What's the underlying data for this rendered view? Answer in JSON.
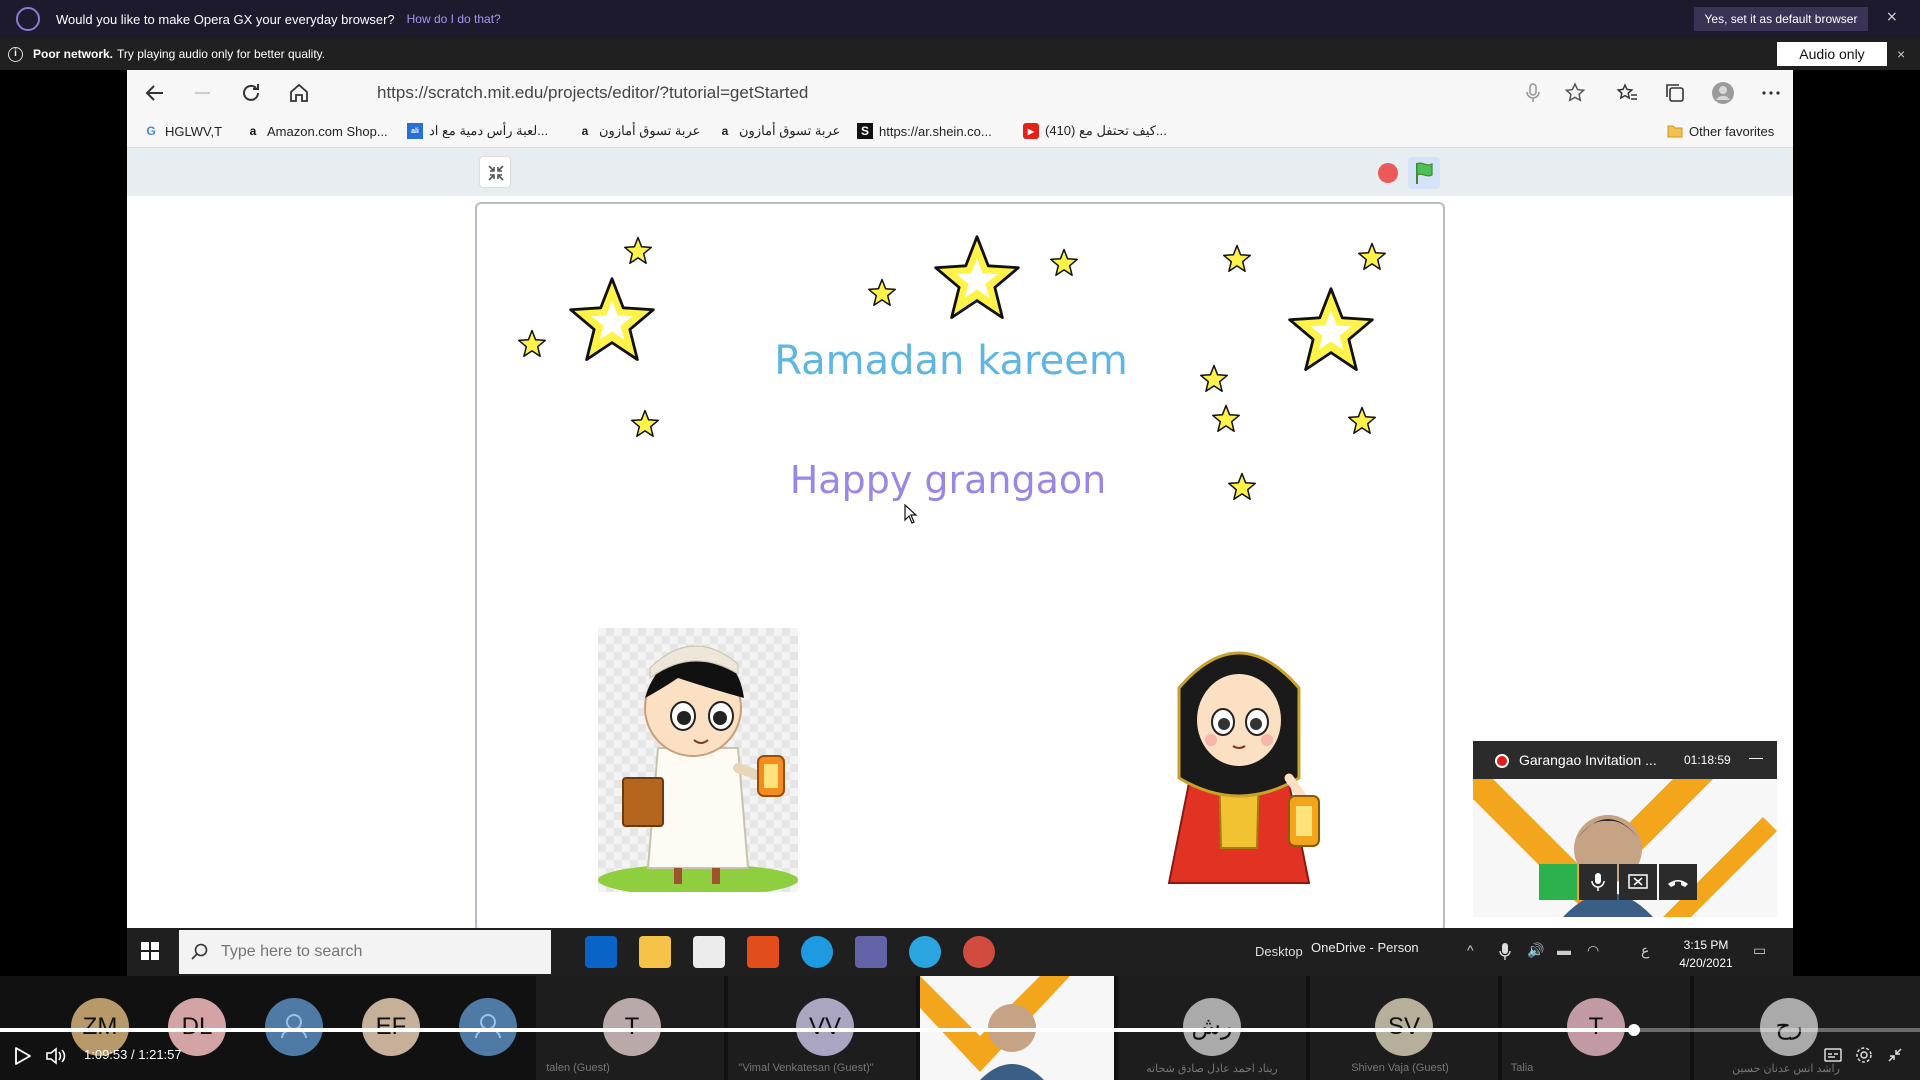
{
  "opera_bar": {
    "message": "Would you like to make Opera GX your everyday browser?",
    "link": "How do I do that?",
    "default_button": "Yes, set it as default browser",
    "close": "×"
  },
  "network_bar": {
    "title": "Poor network.",
    "text": "Try playing audio only for better quality.",
    "audio_only_button": "Audio only",
    "close": "×"
  },
  "browser": {
    "url": "https://scratch.mit.edu/projects/editor/?tutorial=getStarted",
    "favorites": [
      {
        "label": "HGLWV,T",
        "icon": "google-icon"
      },
      {
        "label": "Amazon.com Shop...",
        "icon": "amazon-icon"
      },
      {
        "label": "لعبة رأس دمية مع اد...",
        "icon": "alibaba-icon"
      },
      {
        "label": "عربة تسوق أمازون",
        "icon": "amazon-icon"
      },
      {
        "label": "عربة تسوق أمازون",
        "icon": "amazon-icon"
      },
      {
        "label": "https://ar.shein.co...",
        "icon": "shein-icon"
      },
      {
        "label": "(410) كيف تحتفل مع...",
        "icon": "youtube-icon"
      }
    ],
    "other_favorites": "Other favorites"
  },
  "stage": {
    "title": "Ramadan kareem",
    "subtitle": "Happy grangaon"
  },
  "taskbar": {
    "search_placeholder": "Type here to search",
    "desktop_label": "Desktop",
    "onedrive_label": "OneDrive - Person",
    "time": "3:15 PM",
    "date": "4/20/2021",
    "lang": "ع"
  },
  "mini_window": {
    "title": "Garangao Invitation ...",
    "timer": "01:18:59",
    "minimize": "—"
  },
  "participants": [
    {
      "initials": "ZM",
      "name": "",
      "color": "#b89a6a"
    },
    {
      "initials": "DL",
      "name": "",
      "color": "#d3a3a6"
    },
    {
      "initials": "",
      "name": "",
      "color": "#4f7aa6"
    },
    {
      "initials": "EF",
      "name": "",
      "color": "#c7b09a"
    },
    {
      "initials": "",
      "name": "",
      "color": "#4f7aa6"
    },
    {
      "initials": "T",
      "name": "talen (Guest)",
      "color": "#b9aaa9"
    },
    {
      "initials": "VV",
      "name": "\"Vimal Venkatesan (Guest)\"",
      "color": "#aaa6c2"
    },
    {
      "initials": "رش",
      "name": "ريناد احمد عادل صادق شحاته",
      "color": "#aaaaaa"
    },
    {
      "initials": "SV",
      "name": "Shiven Vaja (Guest)",
      "color": "#b6b09a"
    },
    {
      "initials": "T",
      "name": "Talia",
      "color": "#c29aa3"
    },
    {
      "initials": "رح",
      "name": "راشد انس عدنان حسين",
      "color": "#aaaaaa"
    }
  ],
  "player": {
    "current_time": "1:09:53",
    "separator": "/",
    "duration": "1:21:57",
    "progress": 0.851
  }
}
